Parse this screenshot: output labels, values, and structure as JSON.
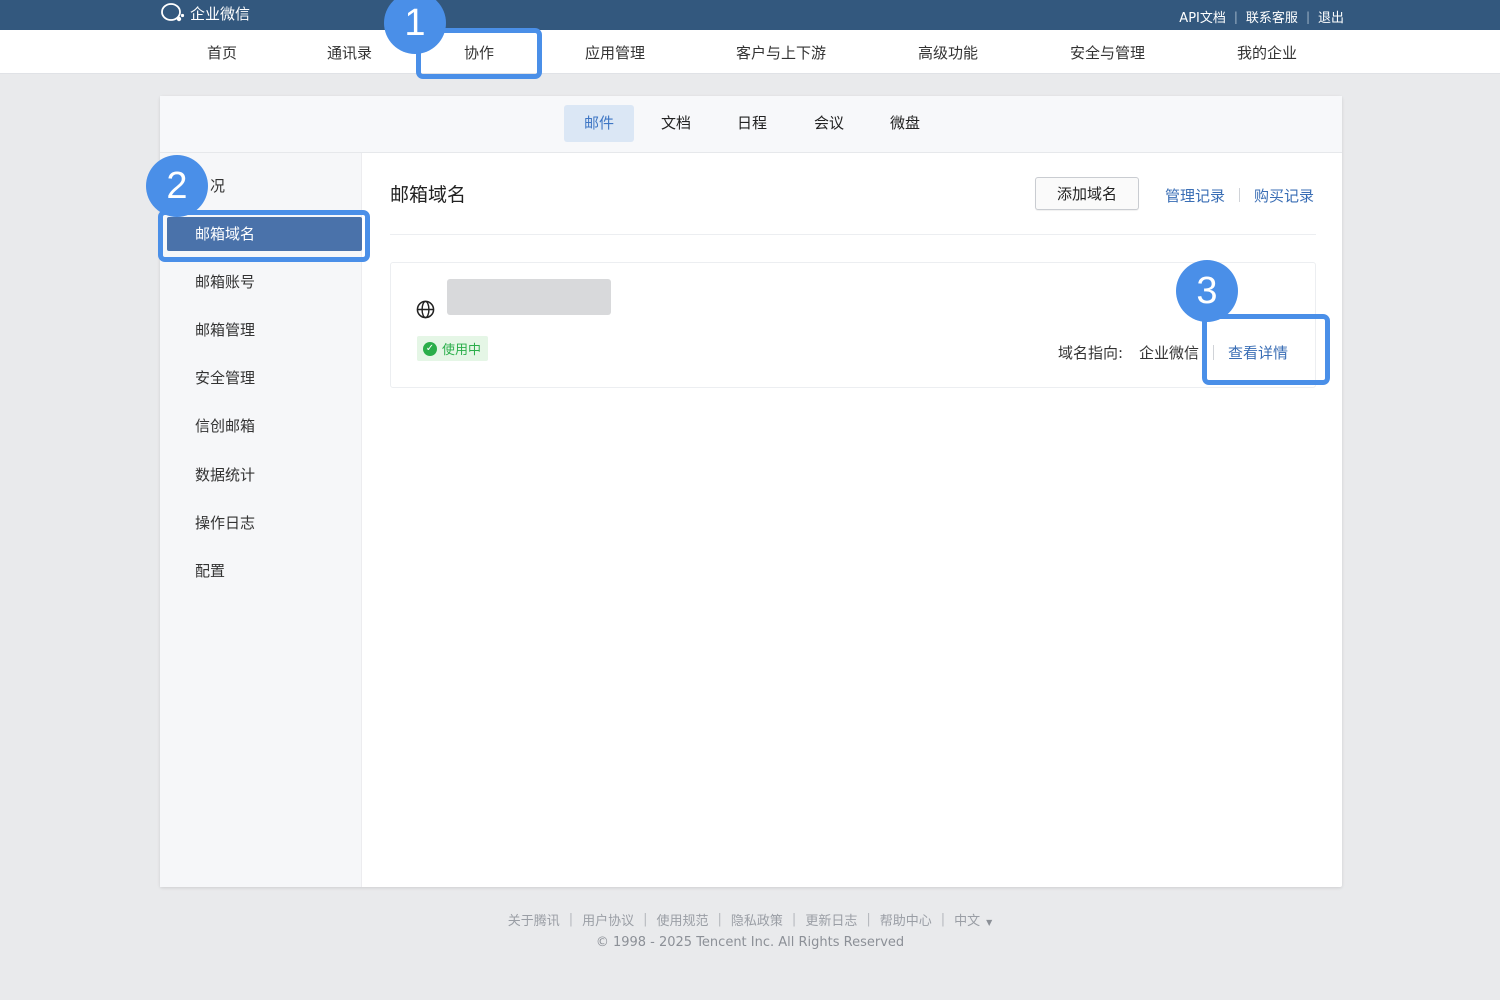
{
  "topbar": {
    "brand": "企业微信",
    "links": [
      "API文档",
      "联系客服",
      "退出"
    ]
  },
  "mainnav": {
    "items": [
      "首页",
      "通讯录",
      "协作",
      "应用管理",
      "客户与上下游",
      "高级功能",
      "安全与管理",
      "我的企业"
    ],
    "active": "协作"
  },
  "subnav": {
    "tabs": [
      "邮件",
      "文档",
      "日程",
      "会议",
      "微盘"
    ],
    "active": "邮件"
  },
  "sidebar": {
    "items": [
      "况",
      "邮箱域名",
      "邮箱账号",
      "邮箱管理",
      "安全管理",
      "信创邮箱",
      "数据统计",
      "操作日志",
      "配置"
    ],
    "active": "邮箱域名"
  },
  "content": {
    "title": "邮箱域名",
    "add_button": "添加域名",
    "manage_records": "管理记录",
    "purchase_records": "购买记录",
    "domain": {
      "status": "使用中",
      "dest_label": "域名指向:",
      "dest_value": "企业微信",
      "detail_link": "查看详情"
    }
  },
  "footer": {
    "links": [
      "关于腾讯",
      "用户协议",
      "使用规范",
      "隐私政策",
      "更新日志",
      "帮助中心",
      "中文"
    ],
    "copyright": "© 1998 - 2025 Tencent Inc. All Rights Reserved"
  },
  "annotations": [
    "1",
    "2",
    "3"
  ],
  "colors": {
    "topbar": "#33587e",
    "accent": "#3a6eb5",
    "highlight": "#4a8fe8",
    "status_green": "#2aae4a"
  }
}
